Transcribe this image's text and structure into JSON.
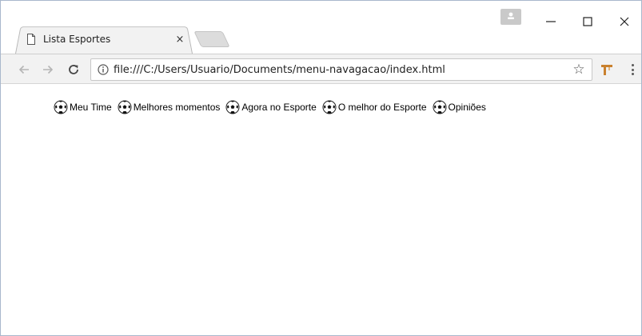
{
  "browser": {
    "tab_title": "Lista Esportes",
    "tab_close_glyph": "×",
    "url": "file:///C:/Users/Usuario/Documents/menu-navagacao/index.html",
    "star_glyph": "☆"
  },
  "icons": {
    "back": "arrow-left-icon",
    "forward": "arrow-right-icon",
    "reload": "reload-icon",
    "info": "info-icon",
    "bookmark": "star-icon",
    "profile": "profile-icon",
    "menu": "more-vert-icon",
    "nav_item": "soccer-ball-icon"
  },
  "page": {
    "menu": [
      {
        "label": "Meu Time"
      },
      {
        "label": "Melhores momentos"
      },
      {
        "label": "Agora no Esporte"
      },
      {
        "label": "O melhor do Esporte"
      },
      {
        "label": "Opiniões"
      }
    ]
  },
  "colors": {
    "toolbar_bg": "#f2f2f2",
    "tab_bg": "#f2f2f2",
    "window_border": "#a9b8cc",
    "link_text": "#000000"
  }
}
